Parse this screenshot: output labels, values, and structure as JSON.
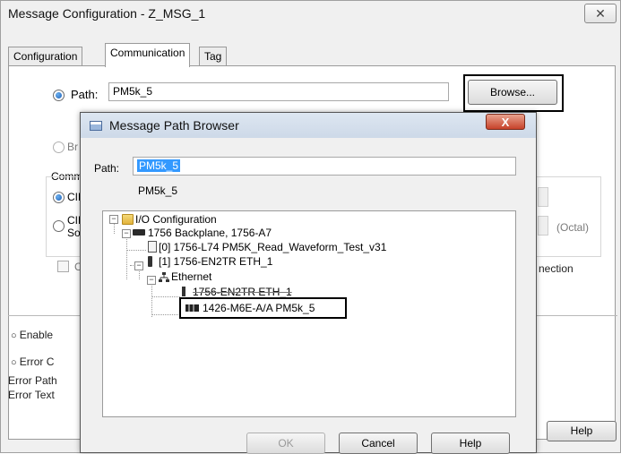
{
  "window": {
    "title": "Message Configuration - Z_MSG_1",
    "close_glyph": "✕"
  },
  "tabs": [
    {
      "label": "Configuration",
      "active": false
    },
    {
      "label": "Communication",
      "active": true
    },
    {
      "label": "Tag",
      "active": false
    }
  ],
  "communication": {
    "path_label": "Path:",
    "path_value": "PM5k_5",
    "browse_label": "Browse...",
    "broadcast_fragment": "Br",
    "comm_group_fragment": "Comm",
    "cip_fragment": "CIP",
    "cip2_fragment_a": "CIF",
    "cip2_fragment_b": "So",
    "checkbox_fragment": "C",
    "octal_label": "(Octal)",
    "connection_fragment": "nection",
    "enable_fragment": "Enable",
    "error_code_fragment": "Error C",
    "error_path_fragment": "Error Path",
    "error_text_fragment": "Error Text",
    "help_label": "Help"
  },
  "path_browser": {
    "title": "Message Path Browser",
    "close_glyph": "X",
    "path_label": "Path:",
    "path_value": "PM5k_5",
    "resolved_path": "PM5k_5",
    "tree": [
      {
        "label": "I/O Configuration",
        "icon": "folder-icon"
      },
      {
        "label": "1756 Backplane, 1756-A7",
        "icon": "backplane-icon"
      },
      {
        "label": "[0] 1756-L74 PM5K_Read_Waveform_Test_v31",
        "icon": "controller-icon"
      },
      {
        "label": "[1] 1756-EN2TR ETH_1",
        "icon": "module-icon"
      },
      {
        "label": "Ethernet",
        "icon": "network-icon"
      },
      {
        "label": "1756-EN2TR ETH_1",
        "icon": "module-icon"
      },
      {
        "label": "1426-M6E-A/A PM5k_5",
        "icon": "powermonitor-icon"
      }
    ],
    "ok_label": "OK",
    "cancel_label": "Cancel",
    "help_label": "Help"
  }
}
